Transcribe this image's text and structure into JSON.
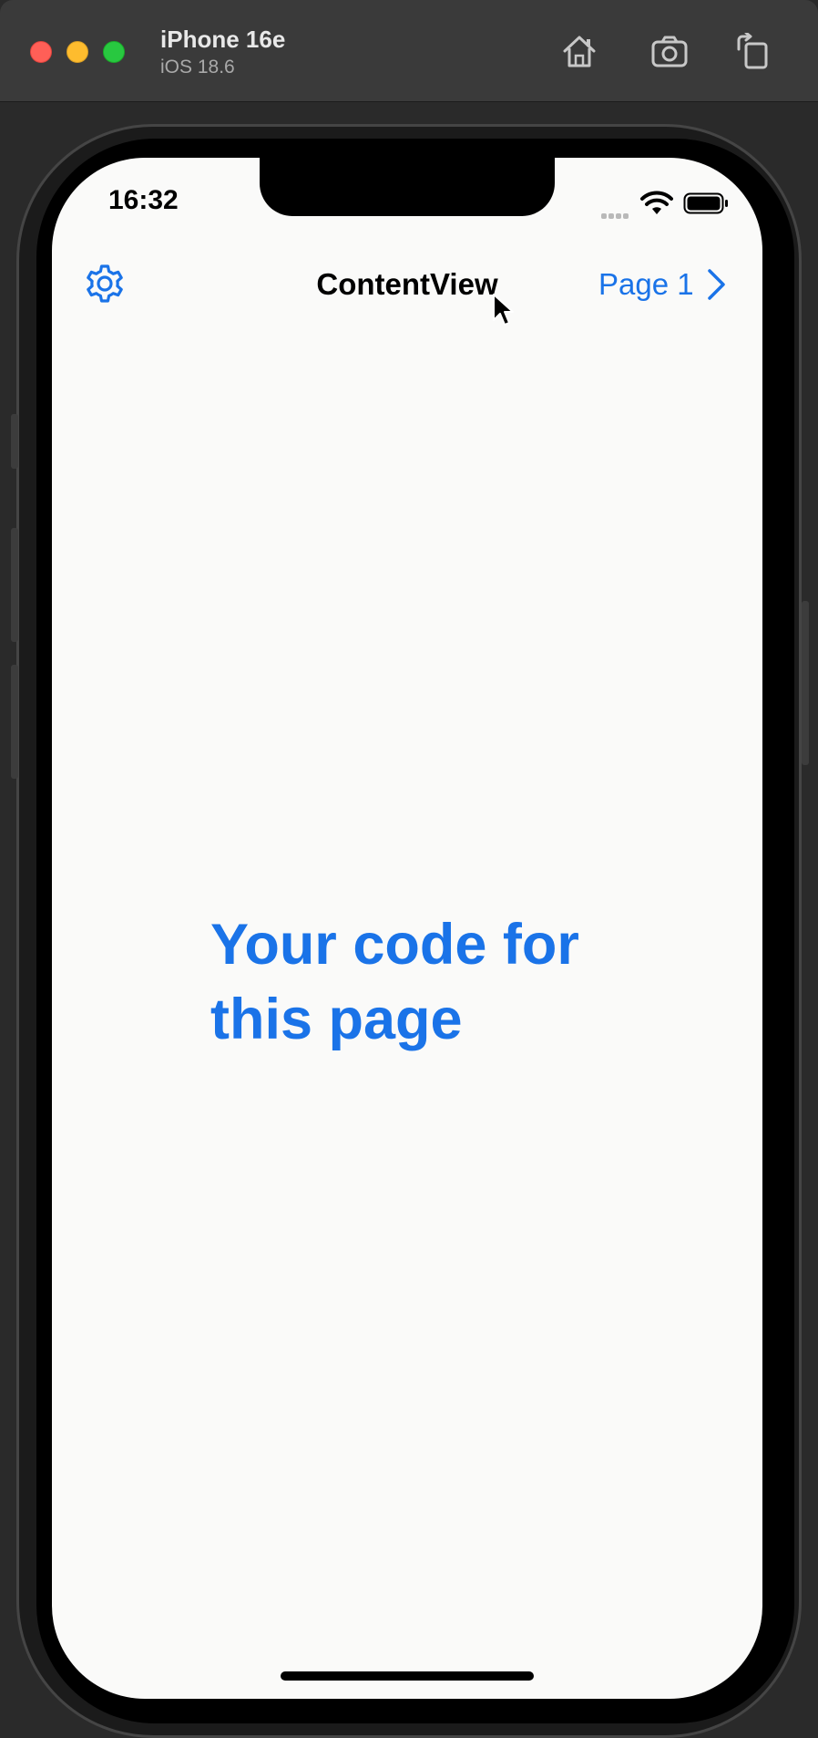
{
  "simulator": {
    "device_name": "iPhone 16e",
    "os_version": "iOS 18.6",
    "toolbar_icons": [
      "home-icon",
      "screenshot-icon",
      "rotate-icon"
    ]
  },
  "status_bar": {
    "time": "16:32"
  },
  "nav_bar": {
    "title": "ContentView",
    "right_label": "Page 1",
    "left_icon": "gear-icon",
    "right_icon": "chevron-right-icon"
  },
  "main": {
    "text": "Your code for this page"
  },
  "colors": {
    "accent": "#1a73e8",
    "background": "#fafaf9",
    "titlebar": "#3a3a3a"
  }
}
